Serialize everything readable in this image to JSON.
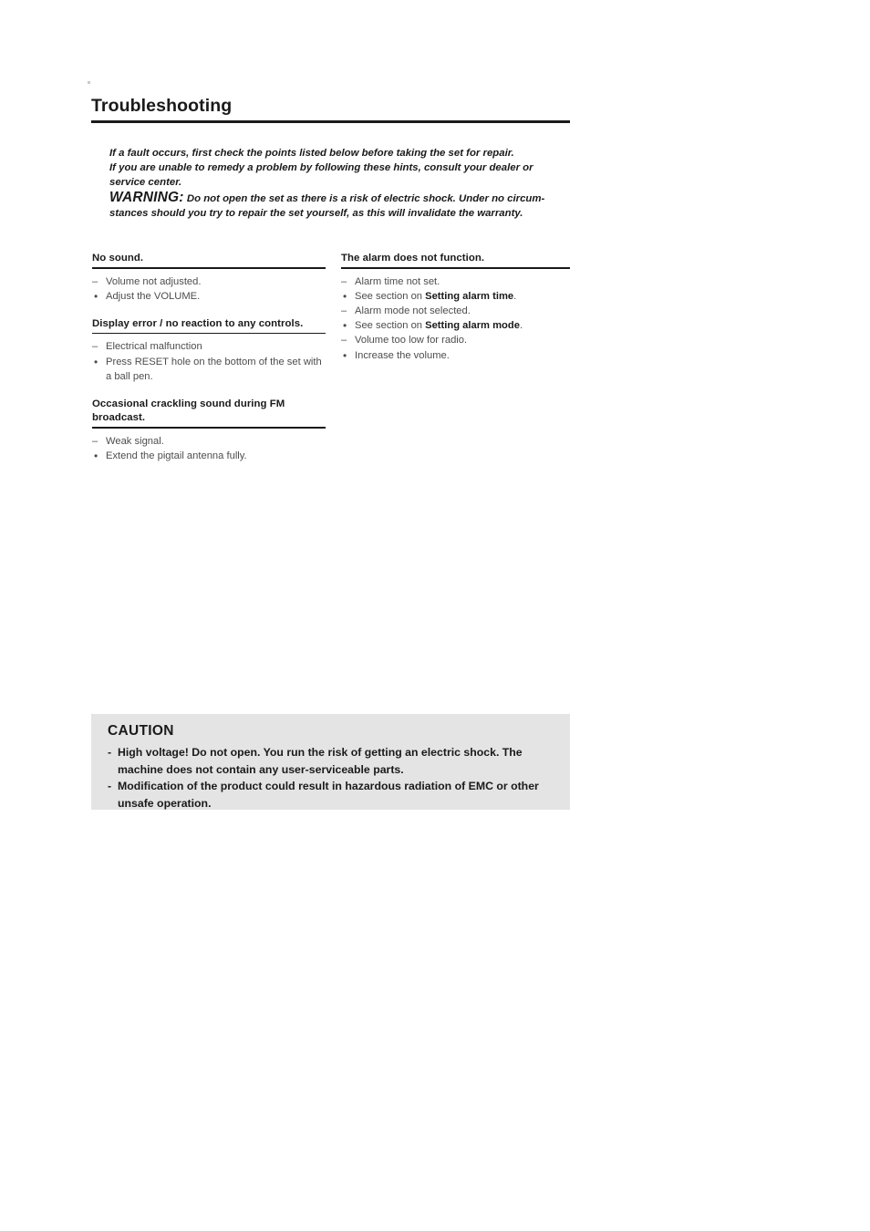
{
  "document": {
    "heading": "Troubleshooting",
    "intro": {
      "line1": "If a fault occurs, first check the points listed below before taking the set for repair.",
      "line2": "If you are unable to remedy a problem by following these hints, consult your dealer or",
      "line3": "service center.",
      "warning_label": "WARNING:",
      "warning_text": "Do not open the set as there is a risk of electric shock. Under no circum-stances should you try to repair the set yourself, as this will invalidate the warranty."
    },
    "columns": {
      "left": [
        {
          "title": "No sound.",
          "items": [
            {
              "marker": "dash",
              "text": "Volume not adjusted."
            },
            {
              "marker": "bullet",
              "text": "Adjust the VOLUME."
            }
          ]
        },
        {
          "title": "Display error / no reaction to any controls.",
          "items": [
            {
              "marker": "dash",
              "text": "Electrical malfunction"
            },
            {
              "marker": "bullet",
              "text": "Press RESET hole on the bottom of the set with a ball pen."
            }
          ]
        },
        {
          "title": "Occasional crackling sound during FM broadcast.",
          "items": [
            {
              "marker": "dash",
              "text": "Weak signal."
            },
            {
              "marker": "bullet",
              "text": "Extend the pigtail antenna fully."
            }
          ]
        }
      ],
      "right": [
        {
          "title": "The alarm does not function.",
          "items": [
            {
              "marker": "dash",
              "text": "Alarm time not set."
            },
            {
              "marker": "bullet",
              "text_before": "See section on ",
              "bold": "Setting alarm time",
              "text_after": "."
            },
            {
              "marker": "dash",
              "text": "Alarm mode not selected."
            },
            {
              "marker": "bullet",
              "text_before": "See section on ",
              "bold": "Setting alarm mode",
              "text_after": "."
            },
            {
              "marker": "dash",
              "text": "Volume too low for radio."
            },
            {
              "marker": "bullet",
              "text": "Increase the volume."
            }
          ]
        }
      ]
    },
    "caution": {
      "title": "CAUTION",
      "items": [
        "High voltage! Do not open. You run the risk of getting an electric shock. The machine does not contain any user-serviceable parts.",
        "Modification of the product could result in hazardous radiation of EMC or other unsafe operation."
      ],
      "dash": "-",
      "background_color": "#e4e4e4"
    },
    "markers": {
      "dash": "–",
      "bullet": "•"
    }
  }
}
